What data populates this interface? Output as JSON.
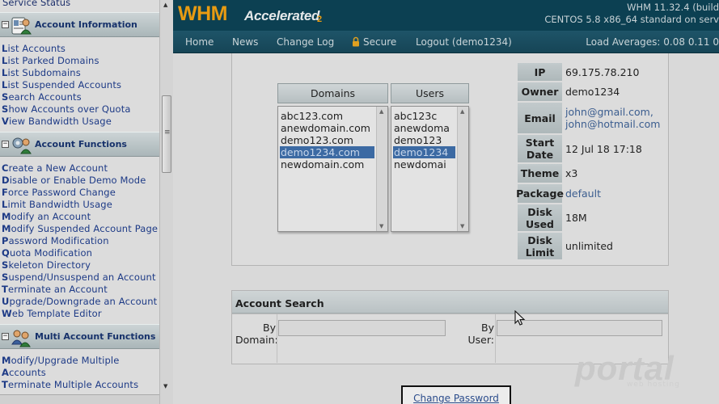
{
  "sidebar": {
    "top_partial": "Service Status",
    "sections": [
      {
        "title": "Account Information",
        "links": [
          "List Accounts",
          "List Parked Domains",
          "List Subdomains",
          "List Suspended Accounts",
          "Search Accounts",
          "Show Accounts over Quota",
          "View Bandwidth Usage"
        ]
      },
      {
        "title": "Account Functions",
        "links": [
          "Create a New Account",
          "Disable or Enable Demo Mode",
          "Force Password Change",
          "Limit Bandwidth Usage",
          "Modify an Account",
          "Modify Suspended Account Page",
          "Password Modification",
          "Quota Modification",
          "Skeleton Directory",
          "Suspend/Unsuspend an Account",
          "Terminate an Account",
          "Upgrade/Downgrade an Account",
          "Web Template Editor"
        ]
      },
      {
        "title": "Multi Account Functions",
        "links": [
          "Modify/Upgrade Multiple",
          "Accounts",
          "Terminate Multiple Accounts"
        ]
      }
    ]
  },
  "header": {
    "logo_whm": "WHM",
    "logo_accelerated": "Accelerated",
    "logo_two": "2",
    "version_line1": "WHM 11.32.4 (build",
    "version_line2": "CENTOS 5.8 x86_64 standard on serv"
  },
  "nav": {
    "items": [
      "Home",
      "News",
      "Change Log",
      "Secure",
      "Logout (demo1234)"
    ],
    "load_averages": "Load Averages: 0.08 0.11 0"
  },
  "lists": {
    "domains_header": "Domains",
    "users_header": "Users",
    "domains": [
      "abc123.com",
      "anewdomain.com",
      "demo123.com",
      "demo1234.com",
      "newdomain.com"
    ],
    "users": [
      "abc123c",
      "anewdoma",
      "demo123",
      "demo1234",
      "newdomai"
    ],
    "selected_index": 3
  },
  "account_info": {
    "ip_label": "IP",
    "ip": "69.175.78.210",
    "owner_label": "Owner",
    "owner": "demo1234",
    "email_label": "Email",
    "email_1": "john@gmail.com,",
    "email_2": "john@hotmail.com",
    "start_label_1": "Start",
    "start_label_2": "Date",
    "start_date": "12 Jul 18 17:18",
    "theme_label": "Theme",
    "theme": "x3",
    "package_label": "Package",
    "package": "default",
    "disk_used_label_1": "Disk",
    "disk_used_label_2": "Used",
    "disk_used": "18M",
    "disk_limit_label_1": "Disk",
    "disk_limit_label_2": "Limit",
    "disk_limit": "unlimited"
  },
  "search": {
    "title": "Account Search",
    "by_domain_1": "By",
    "by_domain_2": "Domain:",
    "by_user_1": "By",
    "by_user_2": "User:",
    "domain_value": "",
    "user_value": ""
  },
  "change_password_label": "Change Password",
  "watermark": {
    "text": "portal",
    "sub": "web hosting"
  },
  "colors": {
    "header_bg": "#0c4052",
    "nav_bg": "#1e5468",
    "logo_orange": "#e89b12",
    "link_blue": "#1d3a86",
    "selection": "#3c6aa3"
  }
}
